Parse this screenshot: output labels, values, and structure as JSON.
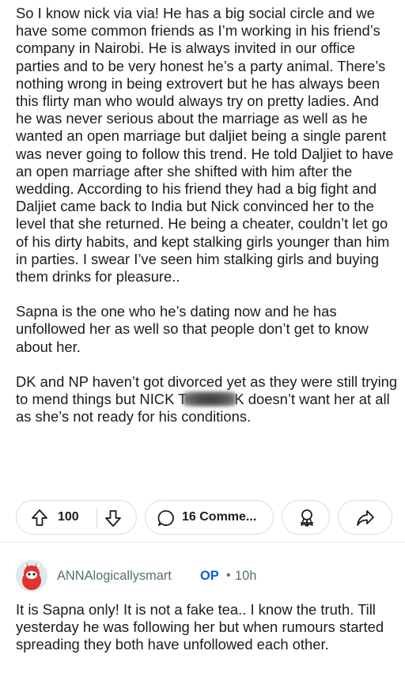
{
  "post": {
    "paragraph_1": "So I know nick via via! He has a big social circle and we have some common friends as I’m working in his friend’s company in Nairobi. He is always invited in our office parties and to be very honest he’s a party animal. There’s nothing wrong in being extrovert but he has always been this flirty man who would always try on pretty ladies. And he was never serious about the marriage as well as he wanted an open marriage  but daljiet being a single parent was never going to follow this trend. He told Daljiet to have an open marriage after she shifted with him after the wedding. According to his friend they had a big fight and Daljiet came back to India but Nick convinced her to the level that she returned. He being a cheater, couldn’t let go of his dirty habits, and kept stalking girls younger than him in parties. I swear I’ve seen him stalking girls and buying them drinks for pleasure..",
    "paragraph_2": "Sapna is the one who he’s dating now and he has unfollowed her as well so that people don’t get to know about her.",
    "paragraph_3_before": "DK and NP haven’t got divorced yet as they were still trying to mend things but NICK T",
    "paragraph_3_after": "K doesn’t want her at all as she’s not ready for his conditions."
  },
  "actions": {
    "upvote_count": "100",
    "comments_label": "16 Comme..."
  },
  "comment": {
    "username": "ANNAlogicallysmart",
    "op_badge": "OP",
    "separator": "•",
    "age": "10h",
    "body": "It is Sapna only! It is not a fake tea.. I know the truth. Till yesterday he was following her but when rumours started spreading they both have unfollowed each other."
  },
  "colors": {
    "op_blue": "#0a5fd1",
    "meta_gray": "#576f76",
    "avatar_red": "#e0342c"
  }
}
